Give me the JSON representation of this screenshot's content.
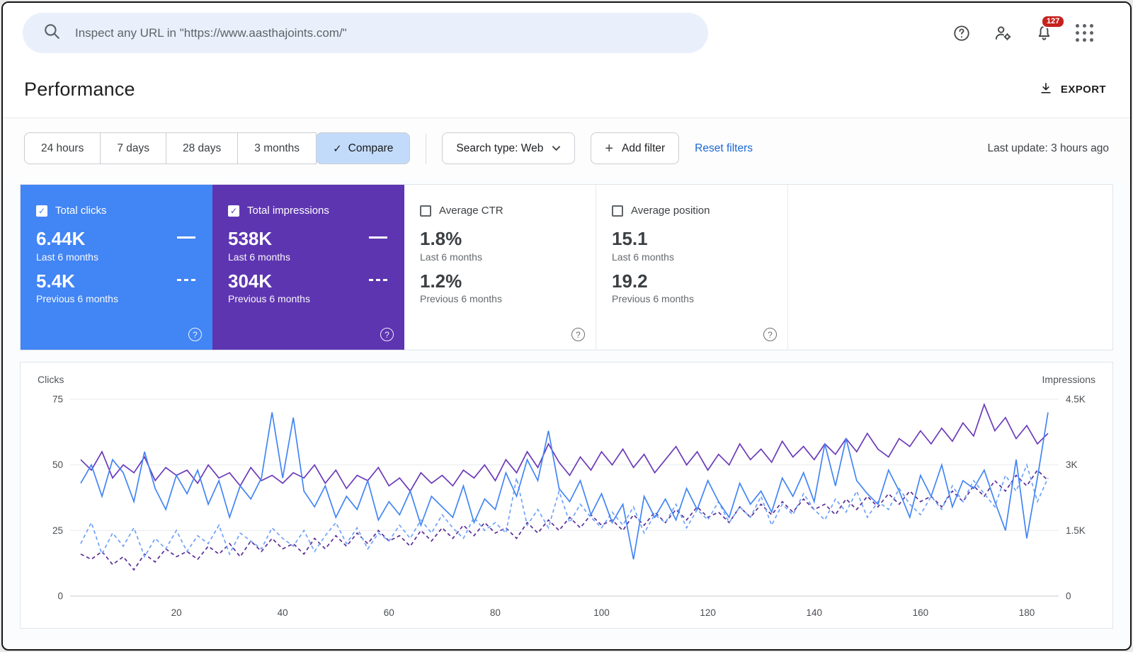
{
  "topbar": {
    "search_placeholder": "Inspect any URL in \"https://www.aasthajoints.com/\"",
    "notification_count": "127"
  },
  "header": {
    "title": "Performance",
    "export_label": "EXPORT"
  },
  "filters": {
    "date_ranges": [
      "24 hours",
      "7 days",
      "28 days",
      "3 months",
      "Compare"
    ],
    "selected_range": "Compare",
    "search_type_label": "Search type: Web",
    "add_filter_label": "Add filter",
    "reset_filters_label": "Reset filters",
    "last_update": "Last update: 3 hours ago"
  },
  "icons": {
    "check": "✓",
    "plus": "+",
    "question": "?"
  },
  "colors": {
    "accent_blue": "#1a73e8",
    "card_blue": "#4285f4",
    "card_purple": "#5e35b1",
    "badge_red": "#c5221f"
  },
  "cards": [
    {
      "label": "Total clicks",
      "checked": true,
      "value1": "6.44K",
      "period1": "Last 6 months",
      "value2": "5.4K",
      "period2": "Previous 6 months",
      "bg": "#4285f4"
    },
    {
      "label": "Total impressions",
      "checked": true,
      "value1": "538K",
      "period1": "Last 6 months",
      "value2": "304K",
      "period2": "Previous 6 months",
      "bg": "#5e35b1"
    },
    {
      "label": "Average CTR",
      "checked": false,
      "value1": "1.8%",
      "period1": "Last 6 months",
      "value2": "1.2%",
      "period2": "Previous 6 months",
      "bg": "#ffffff"
    },
    {
      "label": "Average position",
      "checked": false,
      "value1": "15.1",
      "period1": "Last 6 months",
      "value2": "19.2",
      "period2": "Previous 6 months",
      "bg": "#ffffff"
    }
  ],
  "chart_data": {
    "type": "line",
    "left_axis": {
      "label": "Clicks",
      "max": 75,
      "tick_values": [
        0,
        25,
        50,
        75
      ],
      "tick_labels": [
        "0",
        "25",
        "50",
        "75"
      ]
    },
    "right_axis": {
      "label": "Impressions",
      "max": 4500,
      "tick_labels": [
        "0",
        "1.5K",
        "3K",
        "4.5K"
      ]
    },
    "x_ticks": [
      20,
      40,
      60,
      80,
      100,
      120,
      140,
      160,
      180
    ],
    "x_max": 186,
    "x": [
      2,
      4,
      6,
      8,
      10,
      12,
      14,
      16,
      18,
      20,
      22,
      24,
      26,
      28,
      30,
      32,
      34,
      36,
      38,
      40,
      42,
      44,
      46,
      48,
      50,
      52,
      54,
      56,
      58,
      60,
      62,
      64,
      66,
      68,
      70,
      72,
      74,
      76,
      78,
      80,
      82,
      84,
      86,
      88,
      90,
      92,
      94,
      96,
      98,
      100,
      102,
      104,
      106,
      108,
      110,
      112,
      114,
      116,
      118,
      120,
      122,
      124,
      126,
      128,
      130,
      132,
      134,
      136,
      138,
      140,
      142,
      144,
      146,
      148,
      150,
      152,
      154,
      156,
      158,
      160,
      162,
      164,
      166,
      168,
      170,
      172,
      174,
      176,
      178,
      180,
      182,
      184
    ],
    "series": [
      {
        "name": "Impressions - Previous 6 months",
        "axis": "right",
        "style": "dashed",
        "color": "#5a2d96",
        "values": [
          960,
          840,
          1020,
          720,
          900,
          600,
          960,
          780,
          1080,
          900,
          1020,
          840,
          1140,
          960,
          1200,
          900,
          1260,
          1020,
          1320,
          1080,
          1200,
          960,
          1320,
          1080,
          1380,
          1140,
          1440,
          1200,
          1500,
          1260,
          1380,
          1140,
          1500,
          1260,
          1560,
          1320,
          1620,
          1380,
          1680,
          1440,
          1560,
          1320,
          1680,
          1440,
          1740,
          1500,
          1800,
          1560,
          1860,
          1620,
          1740,
          1500,
          1860,
          1620,
          1920,
          1680,
          1980,
          1740,
          2040,
          1800,
          1920,
          1680,
          2040,
          1800,
          2100,
          1860,
          2160,
          1920,
          2220,
          1980,
          2100,
          1860,
          2220,
          1980,
          2280,
          2040,
          2340,
          2100,
          2400,
          2160,
          2280,
          2040,
          2400,
          2160,
          2520,
          2280,
          2640,
          2400,
          2760,
          2520,
          2880,
          2640
        ]
      },
      {
        "name": "Clicks - Previous 6 months",
        "axis": "left",
        "style": "dashed",
        "color": "#6fa2f8",
        "values": [
          20,
          28,
          16,
          24,
          19,
          26,
          15,
          22,
          18,
          25,
          17,
          23,
          20,
          27,
          16,
          24,
          21,
          18,
          26,
          22,
          19,
          25,
          17,
          23,
          28,
          20,
          26,
          18,
          24,
          21,
          27,
          22,
          29,
          24,
          31,
          26,
          22,
          30,
          25,
          28,
          24,
          45,
          27,
          33,
          26,
          40,
          28,
          35,
          30,
          26,
          32,
          27,
          34,
          24,
          31,
          28,
          35,
          26,
          33,
          29,
          36,
          28,
          34,
          30,
          38,
          27,
          35,
          31,
          39,
          33,
          29,
          37,
          32,
          40,
          30,
          36,
          33,
          41,
          35,
          31,
          38,
          33,
          42,
          36,
          44,
          39,
          34,
          46,
          40,
          50,
          36,
          45
        ]
      },
      {
        "name": "Impressions - Last 6 months",
        "axis": "right",
        "style": "solid",
        "color": "#6b3ab8",
        "values": [
          3120,
          2880,
          3300,
          2700,
          3000,
          2820,
          3180,
          2640,
          2940,
          2760,
          2880,
          2580,
          3000,
          2700,
          2820,
          2520,
          2940,
          2640,
          2760,
          2580,
          2820,
          2700,
          3000,
          2580,
          2880,
          2460,
          2760,
          2640,
          2940,
          2520,
          2700,
          2400,
          2820,
          2580,
          2760,
          2520,
          2880,
          2700,
          3000,
          2640,
          3120,
          2820,
          3300,
          2940,
          3480,
          3060,
          2760,
          3180,
          2880,
          3300,
          3000,
          3360,
          2940,
          3240,
          2820,
          3120,
          3420,
          3000,
          3300,
          2880,
          3240,
          3000,
          3480,
          3120,
          3360,
          3060,
          3540,
          3180,
          3420,
          3120,
          3480,
          3240,
          3600,
          3300,
          3720,
          3360,
          3180,
          3600,
          3420,
          3780,
          3480,
          3840,
          3540,
          3960,
          3660,
          4380,
          3780,
          4080,
          3600,
          3900,
          3480,
          3720
        ]
      },
      {
        "name": "Clicks - Last 6 months",
        "axis": "left",
        "style": "solid",
        "color": "#4285f4",
        "values": [
          43,
          50,
          38,
          52,
          47,
          36,
          55,
          41,
          33,
          46,
          39,
          48,
          35,
          44,
          30,
          42,
          37,
          45,
          70,
          45,
          68,
          40,
          34,
          42,
          30,
          38,
          33,
          44,
          29,
          36,
          31,
          40,
          27,
          38,
          34,
          30,
          42,
          28,
          37,
          33,
          47,
          38,
          52,
          44,
          63,
          41,
          36,
          44,
          31,
          39,
          28,
          35,
          14,
          38,
          30,
          37,
          29,
          41,
          33,
          44,
          36,
          30,
          43,
          35,
          40,
          32,
          45,
          38,
          47,
          36,
          58,
          42,
          60,
          44,
          39,
          35,
          48,
          40,
          30,
          46,
          38,
          50,
          34,
          44,
          41,
          48,
          36,
          25,
          52,
          22,
          45,
          70
        ]
      }
    ]
  }
}
